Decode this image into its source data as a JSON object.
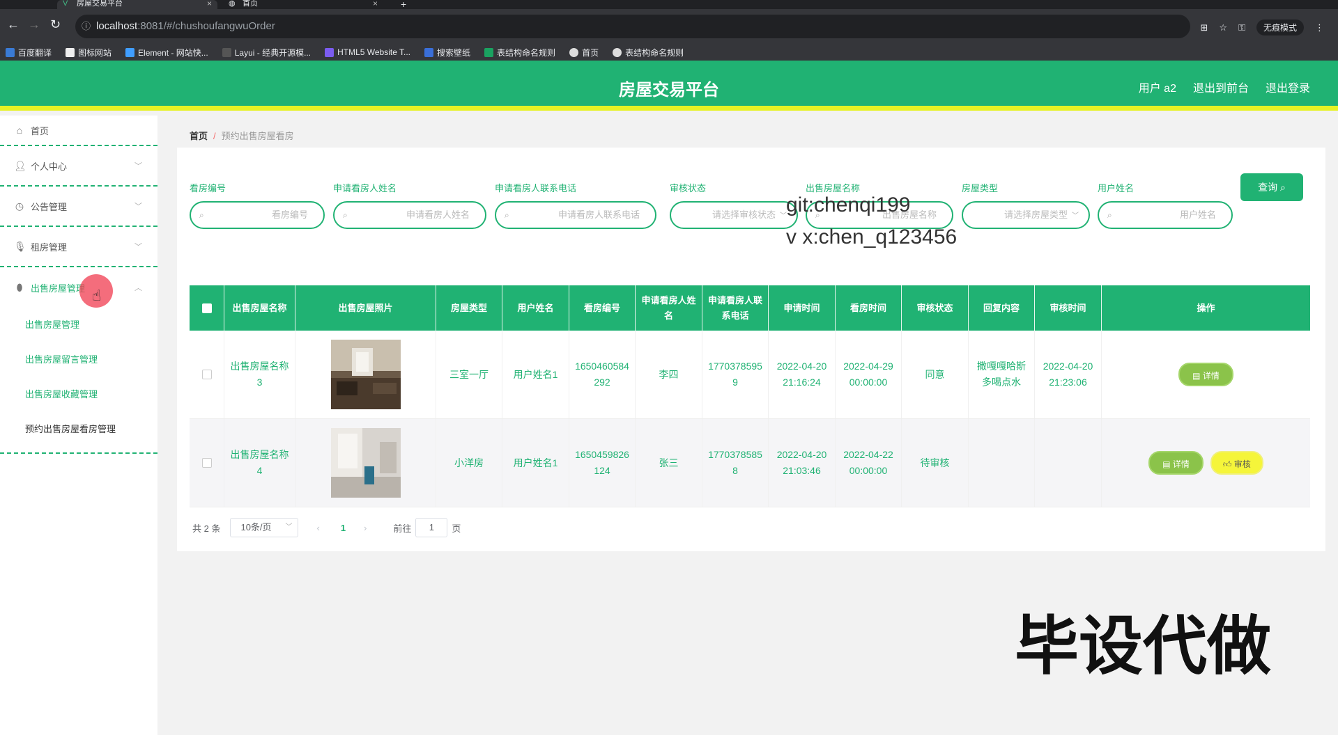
{
  "browser": {
    "tabs": [
      {
        "title": "房屋交易平台"
      },
      {
        "title": "首页"
      }
    ],
    "new_tab": "+",
    "url_host": "localhost",
    "url_path": ":8081/#/chushoufangwuOrder",
    "incognito_label": "无痕模式",
    "bookmarks": [
      "百度翻译",
      "图标网站",
      "Element - 网站快...",
      "Layui - 经典开源模...",
      "HTML5 Website T...",
      "搜索壁纸",
      "表结构命名规则",
      "首页",
      "表结构命名规则"
    ]
  },
  "header": {
    "title": "房屋交易平台",
    "user": "用户 a2",
    "back_front": "退出到前台",
    "logout": "退出登录",
    "color": "#20b273",
    "accent": "#e6f224"
  },
  "sidebar": {
    "home": "首页",
    "personal": "个人中心",
    "notice": "公告管理",
    "rent": "租房管理",
    "sale": "出售房屋管理",
    "sub": [
      "出售房屋管理",
      "出售房屋留言管理",
      "出售房屋收藏管理",
      "预约出售房屋看房管理"
    ]
  },
  "breadcrumb": {
    "home": "首页",
    "sep": "/",
    "current": "预约出售房屋看房"
  },
  "search": {
    "labels": [
      "看房编号",
      "申请看房人姓名",
      "申请看房人联系电话",
      "审核状态",
      "出售房屋名称",
      "房屋类型",
      "用户姓名"
    ],
    "placeholders": [
      "看房编号",
      "申请看房人姓名",
      "申请看房人联系电话",
      "请选择审核状态",
      "出售房屋名称",
      "请选择房屋类型",
      "用户姓名"
    ],
    "query_button": "查询"
  },
  "table": {
    "headers": [
      "出售房屋名称",
      "出售房屋照片",
      "房屋类型",
      "用户姓名",
      "看房编号",
      "申请看房人姓名",
      "申请看房人联系电话",
      "申请时间",
      "看房时间",
      "审核状态",
      "回复内容",
      "审核时间",
      "操作"
    ],
    "rows": [
      {
        "name": "出售房屋名称3",
        "type": "三室一厅",
        "user": "用户姓名1",
        "code": "1650460584292",
        "applicant": "李四",
        "phone": "17703785959",
        "apply_time": "2022-04-20 21:16:24",
        "view_time": "2022-04-29 00:00:00",
        "status": "同意",
        "reply": "撒嘎嘎哈斯多喝点水",
        "audit_time": "2022-04-20 21:23:06",
        "actions": [
          "详情"
        ]
      },
      {
        "name": "出售房屋名称4",
        "type": "小洋房",
        "user": "用户姓名1",
        "code": "1650459826124",
        "applicant": "张三",
        "phone": "17703785858",
        "apply_time": "2022-04-20 21:03:46",
        "view_time": "2022-04-22 00:00:00",
        "status": "待审核",
        "reply": "",
        "audit_time": "",
        "actions": [
          "详情",
          "审核"
        ]
      }
    ]
  },
  "pagination": {
    "total": "共 2 条",
    "page_size": "10条/页",
    "prev": "‹",
    "current": "1",
    "next": "›",
    "goto": "前往",
    "jump_value": "1",
    "page_suffix": "页"
  },
  "overlay": {
    "watermark_line1": "git:chenqi199",
    "watermark_line2": "v x:chen_q123456",
    "promo": "毕设代做"
  }
}
